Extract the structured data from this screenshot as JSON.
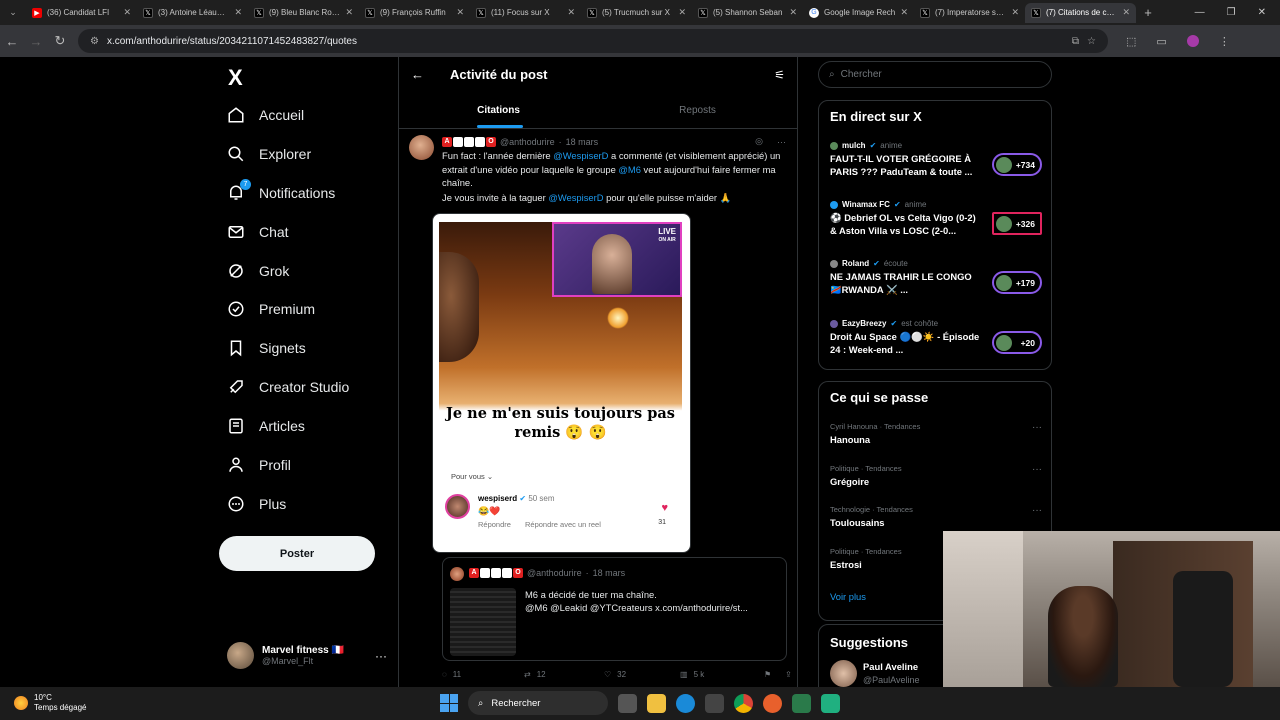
{
  "browser": {
    "tabs": [
      {
        "title": "(36) Candidat LFI",
        "icon": "youtube-icon",
        "active": false
      },
      {
        "title": "(3) Antoine Léaument",
        "icon": "x-icon",
        "active": false
      },
      {
        "title": "(9) Bleu Blanc Rouge",
        "icon": "x-icon",
        "active": false
      },
      {
        "title": "(9) François Ruffin",
        "icon": "x-icon",
        "active": false
      },
      {
        "title": "(11) Focus sur X",
        "icon": "x-icon",
        "active": false
      },
      {
        "title": "(5) Trucmuch sur X",
        "icon": "x-icon",
        "active": false
      },
      {
        "title": "(5) Shannon Seban",
        "icon": "x-icon",
        "active": false
      },
      {
        "title": "Google Image Rech",
        "icon": "google-icon",
        "active": false
      },
      {
        "title": "(7) Imperatorse sur X",
        "icon": "x-icon",
        "active": false
      },
      {
        "title": "(7) Citations de ce post",
        "icon": "x-icon",
        "active": true
      }
    ],
    "url": "x.com/anthodurire/status/2034211071452483827/quotes"
  },
  "sidebar": {
    "logo": "X",
    "items": [
      {
        "label": "Accueil",
        "icon": "home-icon"
      },
      {
        "label": "Explorer",
        "icon": "search-icon"
      },
      {
        "label": "Notifications",
        "icon": "bell-icon",
        "badge": "7"
      },
      {
        "label": "Chat",
        "icon": "mail-icon"
      },
      {
        "label": "Grok",
        "icon": "grok-icon"
      },
      {
        "label": "Premium",
        "icon": "verified-icon"
      },
      {
        "label": "Signets",
        "icon": "bookmark-icon"
      },
      {
        "label": "Creator Studio",
        "icon": "rocket-icon"
      },
      {
        "label": "Articles",
        "icon": "article-icon"
      },
      {
        "label": "Profil",
        "icon": "person-icon"
      },
      {
        "label": "Plus",
        "icon": "more-circle-icon"
      }
    ],
    "post_button": "Poster",
    "account": {
      "name": "Marvel fitness 🇫🇷",
      "handle": "@Marvel_Flt"
    }
  },
  "main": {
    "header_title": "Activité du post",
    "tabs": [
      "Citations",
      "Reposts"
    ],
    "tweet": {
      "handle": "@anthodurire",
      "date": "18 mars",
      "text_parts": [
        {
          "t": "Fun fact : l'année dernière ",
          "link": false
        },
        {
          "t": "@WespiserD",
          "link": true
        },
        {
          "t": " a commenté (et visiblement apprécié) un extrait d'une vidéo pour laquelle le groupe ",
          "link": false
        },
        {
          "t": "@M6",
          "link": true
        },
        {
          "t": " veut aujourd'hui faire fermer ma chaîne.",
          "link": false
        }
      ],
      "text_line2_parts": [
        {
          "t": "Je vous invite à la taguer ",
          "link": false
        },
        {
          "t": "@WespiserD",
          "link": true
        },
        {
          "t": " pour qu'elle puisse m'aider 🙏",
          "link": false
        }
      ],
      "media": {
        "live_label": "LIVE",
        "live_sub": "ON AIR",
        "caption": "Je ne m'en suis toujours pas remis 😲 😲",
        "pour_vous": "Pour vous",
        "comment": {
          "user": "wespiserd",
          "time": "50 sem",
          "emoji": "😂❤️",
          "reply": "Répondre",
          "reply_reel": "Répondre avec un reel",
          "likes": "31"
        }
      }
    },
    "quoted": {
      "handle": "@anthodurire",
      "date": "18 mars",
      "line1": "M6 a décidé de tuer ma chaîne.",
      "line2": "@M6 @Leakid @YTCreateurs x.com/anthodurire/st..."
    },
    "actions": {
      "replies": "11",
      "reposts": "12",
      "likes": "32",
      "views": "5 k"
    }
  },
  "right": {
    "search_placeholder": "Chercher",
    "live": {
      "title": "En direct sur X",
      "items": [
        {
          "user": "mulch",
          "action": "anime",
          "title": "FAUT-T-IL VOTER GRÉGOIRE À PARIS ??? PaduTeam & toute ...",
          "count": "+734"
        },
        {
          "user": "Winamax FC",
          "action": "anime",
          "title": "⚽ Debrief OL vs Celta Vigo (0-2) & Aston Villa vs LOSC (2-0...",
          "count": "+326"
        },
        {
          "user": "Roland",
          "action": "écoute",
          "title": "NE JAMAIS TRAHIR LE CONGO 🇨🇩RWANDA ⚔️ ...",
          "count": "+179"
        },
        {
          "user": "EazyBreezy",
          "action": "est cohôte",
          "title": "Droit Au Space 🔵⚪☀️ - Épisode 24 : Week-end ...",
          "count": "+20"
        }
      ]
    },
    "trends": {
      "title": "Ce qui se passe",
      "items": [
        {
          "context": "Cyril Hanouna · Tendances",
          "name": "Hanouna"
        },
        {
          "context": "Politique · Tendances",
          "name": "Grégoire"
        },
        {
          "context": "Technologie · Tendances",
          "name": "Toulousains"
        },
        {
          "context": "Politique · Tendances",
          "name": "Estrosi"
        }
      ],
      "more": "Voir plus"
    },
    "suggestions": {
      "title": "Suggestions",
      "name": "Paul Aveline",
      "handle": "@PaulAveline"
    }
  },
  "taskbar": {
    "temp": "10°C",
    "weather": "Temps dégagé",
    "search": "Rechercher"
  }
}
